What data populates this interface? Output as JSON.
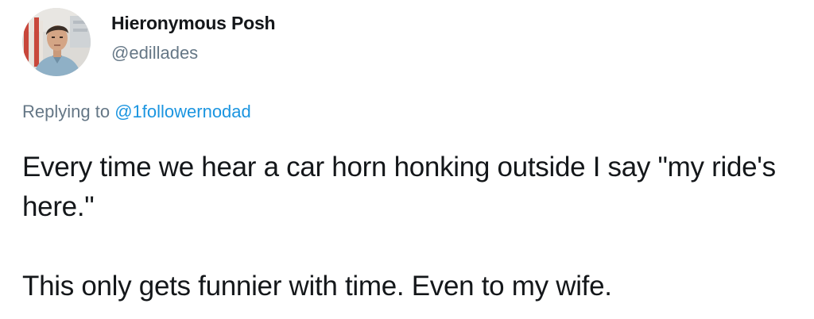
{
  "user": {
    "display_name": "Hieronymous Posh",
    "handle": "@edillades",
    "avatar_icon": "user-avatar-photo"
  },
  "reply": {
    "prefix": "Replying to",
    "target": "@1followernodad"
  },
  "tweet": {
    "paragraphs": [
      "Every time we hear a car horn honking outside I say \"my ride's here.\"",
      "This only gets funnier with time. Even to my wife."
    ]
  },
  "colors": {
    "text": "#14171a",
    "secondary": "#657786",
    "link": "#1b95e0"
  }
}
